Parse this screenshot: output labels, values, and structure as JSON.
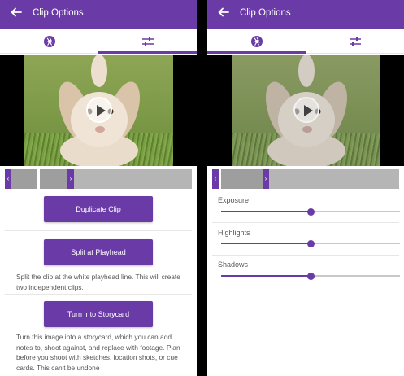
{
  "left_screen": {
    "appbar": {
      "back_icon": "arrow-left-icon",
      "title": "Clip Options"
    },
    "tabs": [
      {
        "icon": "aperture-icon",
        "selected": false
      },
      {
        "icon": "sliders-icon",
        "selected": true
      }
    ],
    "preview": {
      "play_icon": "play-icon"
    },
    "scrubber": {
      "left_handle": "‹",
      "right_handle": "›"
    },
    "actions": [
      {
        "label": "Duplicate Clip",
        "description": ""
      },
      {
        "label": "Split at Playhead",
        "description": "Split the clip at the white playhead line. This will create two independent clips."
      },
      {
        "label": "Turn into Storycard",
        "description": "Turn this image into a storycard, which you can add notes to, shoot against, and replace with footage. Plan before you shoot with sketches, location shots, or cue cards. This can't be undone"
      }
    ]
  },
  "right_screen": {
    "appbar": {
      "back_icon": "arrow-left-icon",
      "title": "Clip Options"
    },
    "tabs": [
      {
        "icon": "aperture-icon",
        "selected": true
      },
      {
        "icon": "sliders-icon",
        "selected": false
      }
    ],
    "preview": {
      "play_icon": "play-icon"
    },
    "scrubber": {
      "left_handle": "‹",
      "right_handle": "›"
    },
    "adjustments": [
      {
        "label": "Exposure",
        "value_fraction": 0.5
      },
      {
        "label": "Highlights",
        "value_fraction": 0.5
      },
      {
        "label": "Shadows",
        "value_fraction": 0.5
      }
    ]
  },
  "colors": {
    "accent": "#6a3aa7",
    "appbar": "#6a3aa7",
    "track": "#c8c8c8",
    "scrubber": "#b5b5b5"
  }
}
